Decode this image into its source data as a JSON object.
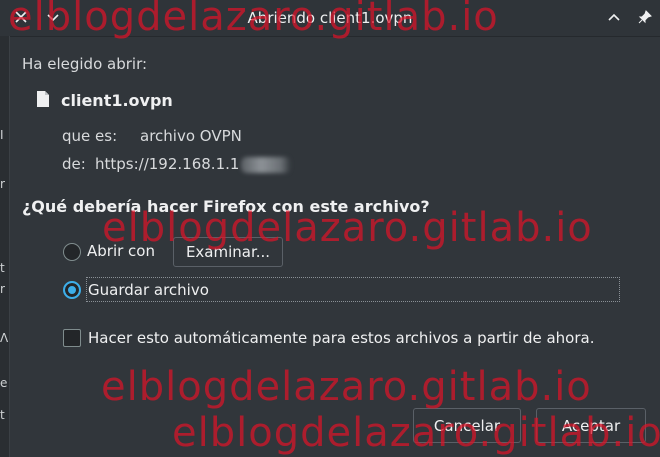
{
  "titlebar": {
    "title": "Abriendo client1.ovpn",
    "close_icon": "close-icon",
    "menu_icon": "chevron-down-icon",
    "collapse_icon": "chevron-up-icon",
    "pin_icon": "pin-icon"
  },
  "left_strip_chars": [
    "I",
    "r",
    "t",
    "r",
    "Λ",
    "e",
    "t"
  ],
  "dialog": {
    "intro": "Ha elegido abrir:",
    "filename": "client1.ovpn",
    "type_label": "que es:",
    "type_value": "archivo OVPN",
    "from_label": "de:",
    "from_value": "https://192.168.1.1",
    "question": "¿Qué debería hacer Firefox con este archivo?",
    "open_with_label": "Abrir con",
    "browse_button": "Examinar...",
    "save_label": "Guardar archivo",
    "auto_label": "Hacer esto automáticamente para estos archivos a partir de ahora.",
    "selected_option": "save"
  },
  "footer": {
    "cancel_button": "Cancelar",
    "accept_button": "Aceptar"
  },
  "watermark": "elblogdelazaro.gitlab.io",
  "colors": {
    "background": "#31363b",
    "accent": "#3daee9",
    "watermark": "#dc1428"
  }
}
